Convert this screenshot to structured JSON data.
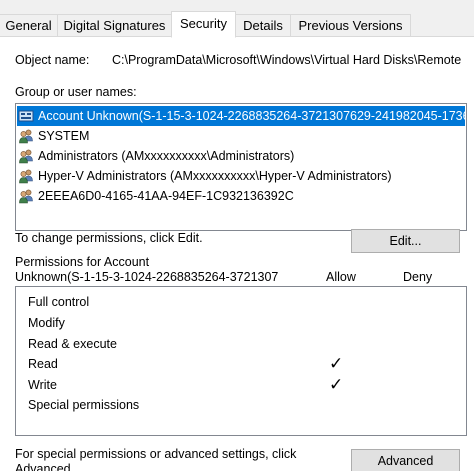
{
  "tabs": [
    {
      "label": "General"
    },
    {
      "label": "Digital Signatures"
    },
    {
      "label": "Security"
    },
    {
      "label": "Details"
    },
    {
      "label": "Previous Versions"
    }
  ],
  "object_name": {
    "label": "Object name:",
    "value": "C:\\ProgramData\\Microsoft\\Windows\\Virtual Hard Disks\\Remote"
  },
  "group": {
    "label": "Group or user names:",
    "items": [
      {
        "name": "Account Unknown(S-1-15-3-1024-2268835264-3721307629-241982045-1736...",
        "icon": "unknown-account-icon",
        "selected": true
      },
      {
        "name": "SYSTEM",
        "icon": "users-icon"
      },
      {
        "name": "Administrators (AMxxxxxxxxxx\\Administrators)",
        "icon": "users-icon"
      },
      {
        "name": "Hyper-V Administrators (AMxxxxxxxxxx\\Hyper-V Administrators)",
        "icon": "users-icon"
      },
      {
        "name": "2EEEA6D0-4165-41AA-94EF-1C932136392C",
        "icon": "users-icon"
      }
    ]
  },
  "change_hint": "To change permissions, click Edit.",
  "edit_label": "Edit...",
  "permissions": {
    "title_line1": "Permissions for Account",
    "title_line2": "Unknown(S-1-15-3-1024-2268835264-3721307",
    "allow_label": "Allow",
    "deny_label": "Deny",
    "rows": [
      {
        "name": "Full control",
        "allow": false,
        "deny": false
      },
      {
        "name": "Modify",
        "allow": false,
        "deny": false
      },
      {
        "name": "Read & execute",
        "allow": false,
        "deny": false
      },
      {
        "name": "Read",
        "allow": true,
        "deny": false
      },
      {
        "name": "Write",
        "allow": true,
        "deny": false
      },
      {
        "name": "Special permissions",
        "allow": false,
        "deny": false
      }
    ],
    "check_mark": "✓"
  },
  "advanced": {
    "hint_line1": "For special permissions or advanced settings, click",
    "hint_line2": "Advanced.",
    "button_label": "Advanced"
  },
  "colors": {
    "selection": "#0078d7",
    "border": "#828790",
    "button_bg": "#e1e1e1"
  }
}
